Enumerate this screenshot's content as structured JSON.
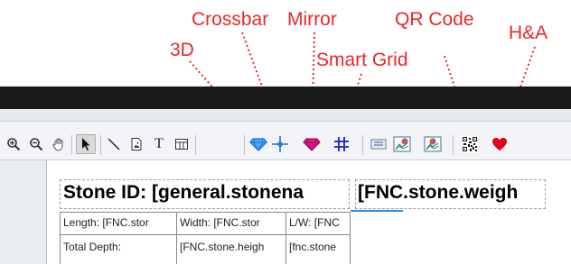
{
  "annotations": {
    "ann_3d": "3D",
    "ann_crossbar": "Crossbar",
    "ann_mirror": "Mirror",
    "ann_smart_grid": "Smart Grid",
    "ann_qr": "QR Code",
    "ann_ha": "H&A",
    "color": "#e8262c"
  },
  "toolbar": {
    "tools": [
      "zoom-in-icon",
      "zoom-out-icon",
      "pan-hand-icon",
      "select-arrow-icon",
      "line-icon",
      "image-icon",
      "text-icon",
      "table-icon",
      "3d-diamond-icon",
      "crossbar-icon",
      "mirror-diamond-icon",
      "smart-grid-icon",
      "barcode-icon",
      "chart-icon",
      "chart-2-icon",
      "qr-code-icon",
      "heart-icon"
    ],
    "text_tool_glyph": "T",
    "accent_blue": "#1e6fe0",
    "mirror_color": "#e0157f"
  },
  "canvas": {
    "title_left": "Stone ID: [general.stonena",
    "title_right": "[FNC.stone.weigh",
    "table": {
      "row1": [
        "Length: [FNC.stor",
        "Width: [FNC.stor",
        "L/W: [FNC"
      ],
      "row2": [
        "Total Depth:",
        "[FNC.stone.heigh",
        "[fnc.stone"
      ]
    }
  }
}
